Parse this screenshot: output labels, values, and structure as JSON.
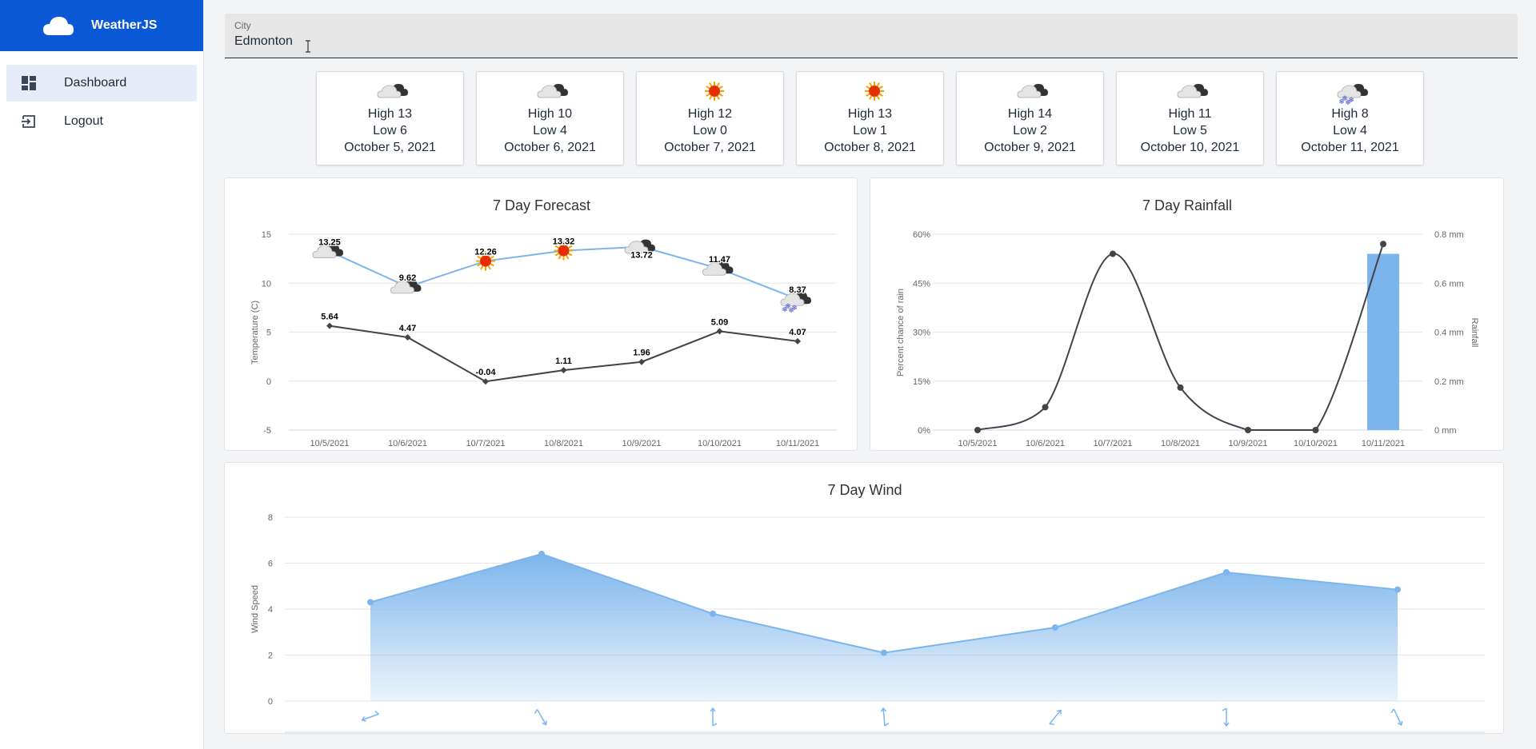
{
  "app": {
    "title": "WeatherJS"
  },
  "nav": {
    "dashboard": "Dashboard",
    "logout": "Logout"
  },
  "city": {
    "label": "City",
    "value": "Edmonton"
  },
  "days": [
    {
      "icon": "cloudy-icon",
      "high": "High 13",
      "low": "Low 6",
      "date": "October 5, 2021"
    },
    {
      "icon": "cloudy-icon",
      "high": "High 10",
      "low": "Low 4",
      "date": "October 6, 2021"
    },
    {
      "icon": "sunny-icon",
      "high": "High 12",
      "low": "Low 0",
      "date": "October 7, 2021"
    },
    {
      "icon": "sunny-icon",
      "high": "High 13",
      "low": "Low 1",
      "date": "October 8, 2021"
    },
    {
      "icon": "cloudy-icon",
      "high": "High 14",
      "low": "Low 2",
      "date": "October 9, 2021"
    },
    {
      "icon": "cloudy-icon",
      "high": "High 11",
      "low": "Low 5",
      "date": "October 10, 2021"
    },
    {
      "icon": "snow-icon",
      "high": "High 8",
      "low": "Low 4",
      "date": "October 11, 2021"
    }
  ],
  "colors": {
    "brand": "#0a58d6",
    "high_line": "#7cb5ec",
    "low_line": "#434348",
    "bar": "#7cb5ec"
  },
  "chart_data": [
    {
      "type": "line",
      "title": "7 Day Forecast",
      "ylabel": "Temperature (C)",
      "categories": [
        "10/5/2021",
        "10/6/2021",
        "10/7/2021",
        "10/8/2021",
        "10/9/2021",
        "10/10/2021",
        "10/11/2021"
      ],
      "ylim": [
        -5,
        15
      ],
      "yticks": [
        15,
        10,
        5,
        0,
        -5
      ],
      "grid": true,
      "series": [
        {
          "values": [
            13.25,
            9.62,
            12.26,
            13.32,
            13.72,
            11.47,
            8.37
          ],
          "labels": [
            "13.25",
            "9.62",
            "12.26",
            "13.32",
            "13.72",
            "11.47",
            "8.37"
          ],
          "color": "#7cb5ec",
          "icons": [
            "cloudy-icon",
            "cloudy-icon",
            "sunny-icon",
            "sunny-icon",
            "cloudy-icon",
            "cloudy-icon",
            "snow-icon"
          ]
        },
        {
          "values": [
            5.64,
            4.47,
            -0.04,
            1.11,
            1.96,
            5.09,
            4.07
          ],
          "labels": [
            "5.64",
            "4.47",
            "-0.04",
            "1.11",
            "1.96",
            "5.09",
            "4.07"
          ],
          "color": "#434348"
        }
      ]
    },
    {
      "type": "bar",
      "title": "7 Day Rainfall",
      "ylabel": "Percent chance of rain",
      "y2label": "Rainfall",
      "categories": [
        "10/5/2021",
        "10/6/2021",
        "10/7/2021",
        "10/8/2021",
        "10/9/2021",
        "10/10/2021",
        "10/11/2021"
      ],
      "yticks": [
        "60%",
        "45%",
        "30%",
        "15%",
        "0%"
      ],
      "y2ticks": [
        "0.8 mm",
        "0.6 mm",
        "0.4 mm",
        "0.2 mm",
        "0 mm"
      ],
      "ylim": [
        0,
        60
      ],
      "y2lim": [
        0,
        0.8
      ],
      "grid": true,
      "series": [
        {
          "kind": "bar",
          "axis": "right",
          "values": [
            0,
            0,
            0,
            0,
            0,
            0,
            0.72
          ],
          "color": "#7cb5ec"
        },
        {
          "kind": "spline",
          "axis": "left",
          "values": [
            0,
            7,
            54,
            13,
            0,
            0,
            57
          ],
          "color": "#434348"
        }
      ]
    },
    {
      "type": "area",
      "title": "7 Day Wind",
      "ylabel": "Wind Speed",
      "ylim": [
        0,
        8
      ],
      "yticks": [
        8,
        6,
        4,
        2,
        0
      ],
      "grid": true,
      "series": [
        {
          "values": [
            4.3,
            6.4,
            3.8,
            2.1,
            3.2,
            5.6,
            4.85
          ],
          "color": "#7cb5ec",
          "directions_deg": [
            250,
            150,
            0,
            355,
            40,
            180,
            155
          ]
        }
      ]
    }
  ]
}
